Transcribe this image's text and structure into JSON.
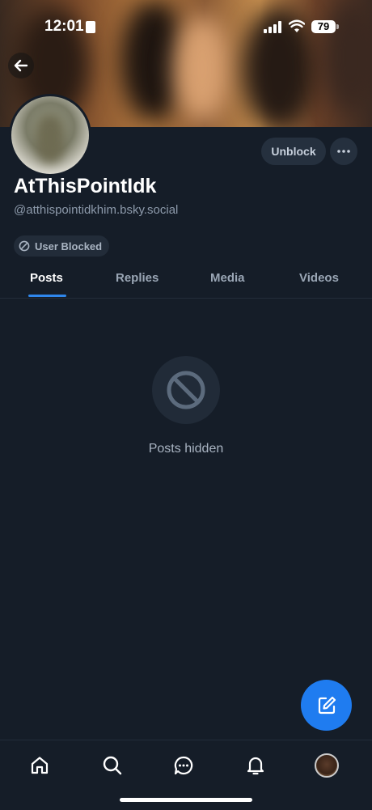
{
  "status_bar": {
    "time": "12:01",
    "battery": "79"
  },
  "profile": {
    "display_name": "AtThisPointIdk",
    "handle": "@atthispointidkhim.bsky.social",
    "blocked_label": "User Blocked",
    "unblock_label": "Unblock"
  },
  "tabs": [
    {
      "label": "Posts",
      "active": true
    },
    {
      "label": "Replies",
      "active": false
    },
    {
      "label": "Media",
      "active": false
    },
    {
      "label": "Videos",
      "active": false
    }
  ],
  "content": {
    "empty_message": "Posts hidden"
  },
  "icons": {
    "back": "arrow-left-icon",
    "more": "ellipsis-icon",
    "blocked": "ban-icon",
    "compose": "compose-icon",
    "nav": [
      "home-icon",
      "search-icon",
      "chat-icon",
      "bell-icon",
      "profile-avatar"
    ]
  },
  "colors": {
    "background": "#151d28",
    "accent": "#2f87ec",
    "fab": "#1f7cf0"
  }
}
